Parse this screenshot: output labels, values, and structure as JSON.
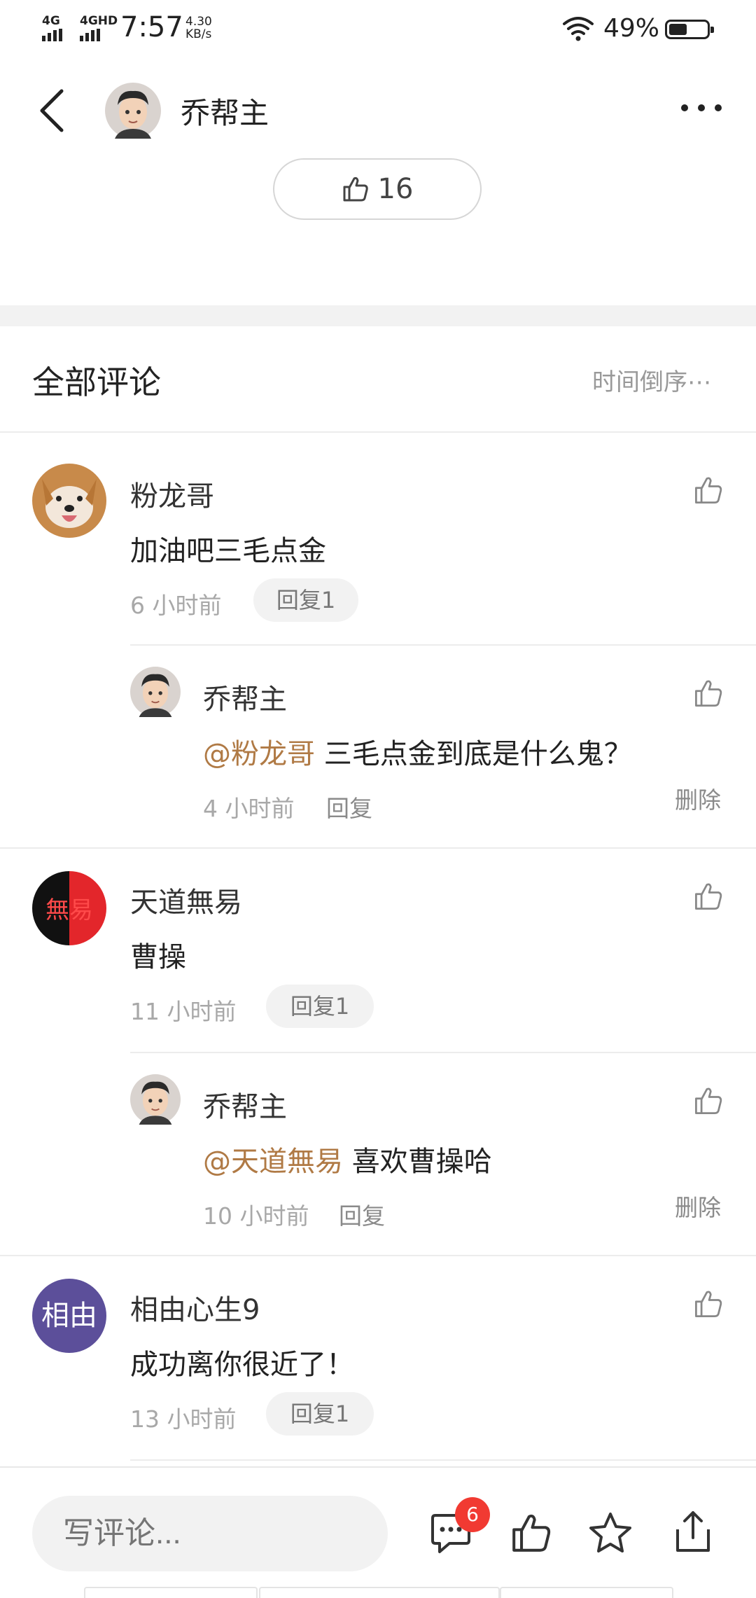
{
  "status_bar": {
    "signal1": "4G",
    "signal2": "4GHD",
    "time": "7:57",
    "speed_value": "4.30",
    "speed_unit": "KB/s",
    "battery": "49%",
    "battery_level": 0.49
  },
  "header": {
    "author": "乔帮主"
  },
  "post": {
    "like_count": "16"
  },
  "comments_section": {
    "title": "全部评论",
    "sort": "时间倒序⋯"
  },
  "comments": [
    {
      "name": "粉龙哥",
      "text": "加油吧三毛点金",
      "time": "6 小时前",
      "reply_label": "回复1",
      "replies": [
        {
          "name": "乔帮主",
          "mention": "@粉龙哥",
          "text": " 三毛点金到底是什么鬼？",
          "time": "4 小时前",
          "reply_label": "回复",
          "delete_label": "删除"
        }
      ]
    },
    {
      "name": "天道無易",
      "avatar_text": "無易",
      "text": "曹操",
      "time": "11 小时前",
      "reply_label": "回复1",
      "replies": [
        {
          "name": "乔帮主",
          "mention": "@天道無易",
          "text": " 喜欢曹操哈",
          "time": "10 小时前",
          "reply_label": "回复",
          "delete_label": "删除"
        }
      ]
    },
    {
      "name": "相由心生9",
      "avatar_text": "相由",
      "text": "成功离你很近了！",
      "time": "13 小时前",
      "reply_label": "回复1",
      "replies": []
    }
  ],
  "bottom_bar": {
    "input_placeholder": "写评论...",
    "comment_badge": "6"
  },
  "colors": {
    "mention": "#b07a45",
    "badge": "#f13a32",
    "avatar_purple": "#5c4f9a"
  }
}
